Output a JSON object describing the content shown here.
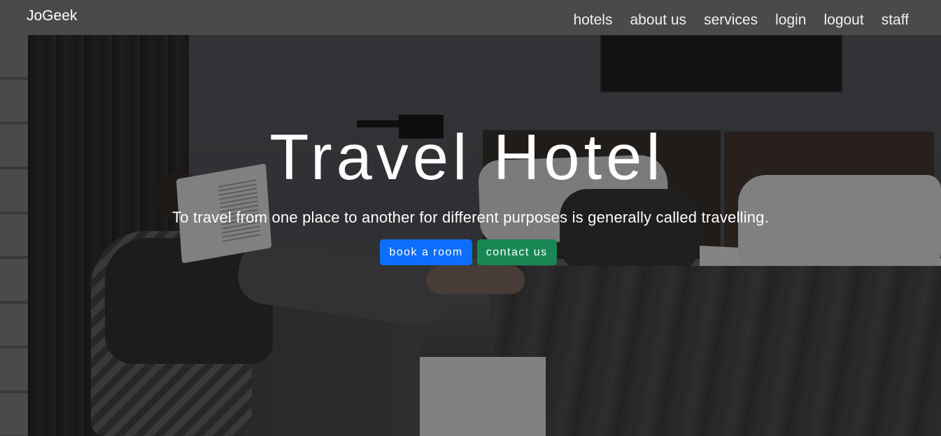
{
  "navbar": {
    "brand": "JoGeek",
    "links": [
      {
        "label": "hotels"
      },
      {
        "label": "about us"
      },
      {
        "label": "services"
      },
      {
        "label": "login"
      },
      {
        "label": "logout"
      },
      {
        "label": "staff"
      }
    ]
  },
  "hero": {
    "title": "Travel Hotel",
    "subtitle": "To travel from one place to another for different purposes is generally called travelling.",
    "buttons": {
      "book": "book a room",
      "contact": "contact us"
    }
  },
  "colors": {
    "navbar_bg": "#4a4a4a",
    "primary": "#0d6efd",
    "success": "#198754"
  }
}
